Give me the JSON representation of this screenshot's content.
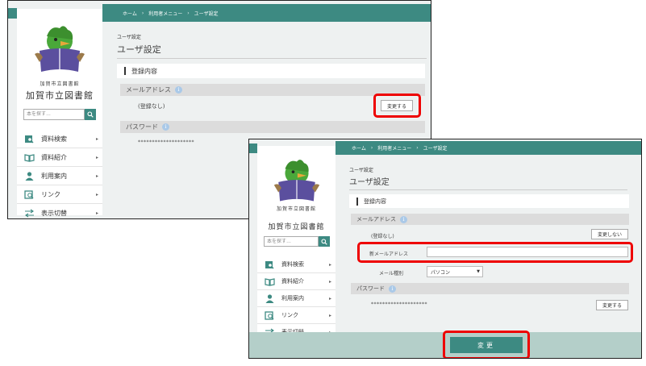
{
  "library": {
    "name": "加賀市立図書館",
    "logo_handwriting": "加賀市立図書館"
  },
  "search": {
    "placeholder": "本を探す…",
    "icon": "search-icon"
  },
  "nav": [
    {
      "label": "資料検索",
      "icon": "book-search-icon"
    },
    {
      "label": "資料紹介",
      "icon": "open-book-icon"
    },
    {
      "label": "利用案内",
      "icon": "person-icon"
    },
    {
      "label": "リンク",
      "icon": "link-icon"
    },
    {
      "label": "表示切替",
      "icon": "swap-arrows-icon"
    }
  ],
  "breadcrumb": [
    "ホーム",
    "利用者メニュー",
    "ユーザ設定"
  ],
  "page": {
    "crumb_label": "ユーザ設定",
    "title": "ユーザ設定",
    "section_title": "登録内容",
    "email_label": "メールアドレス",
    "email_value": "(登録なし)",
    "password_label": "パスワード",
    "password_value": "********************",
    "change_button": "変更する",
    "cancel_change_button": "変更しない",
    "new_email_label": "新メールアドレス",
    "new_email_value": "",
    "mail_type_label": "メール種別",
    "mail_type_value": "パソコン",
    "submit_button": "変更"
  },
  "colors": {
    "accent": "#3d8a82",
    "highlight": "#ee0000",
    "footer": "#b4cfc9"
  }
}
